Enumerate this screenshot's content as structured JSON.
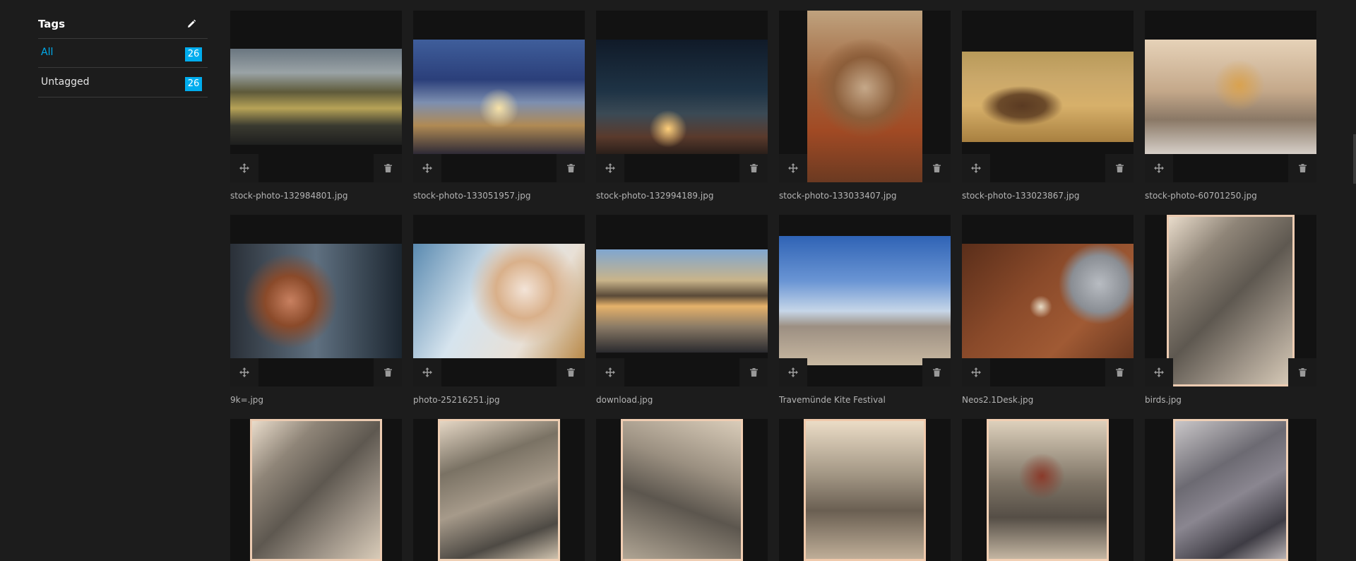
{
  "sidebar": {
    "title": "Tags",
    "tags": [
      {
        "label": "All",
        "count": "26",
        "active": true
      },
      {
        "label": "Untagged",
        "count": "26",
        "active": false
      }
    ]
  },
  "assets": [
    {
      "filename": "stock-photo-132984801.jpg",
      "image": "waterfall-landscape"
    },
    {
      "filename": "stock-photo-133051957.jpg",
      "image": "airplane-runway"
    },
    {
      "filename": "stock-photo-132994189.jpg",
      "image": "night-beach-campfire"
    },
    {
      "filename": "stock-photo-133033407.jpg",
      "image": "sadhu-portrait"
    },
    {
      "filename": "stock-photo-133023867.jpg",
      "image": "deer-in-field"
    },
    {
      "filename": "stock-photo-60701250.jpg",
      "image": "child-bicycle-house"
    },
    {
      "filename": "9k=.jpg",
      "image": "girl-at-window"
    },
    {
      "filename": "photo-25216251.jpg",
      "image": "woman-in-snow"
    },
    {
      "filename": "download.jpg",
      "image": "lake-boathouse"
    },
    {
      "filename": "Travemünde Kite Festival",
      "image": "kite-festival-beach"
    },
    {
      "filename": "Neos2.1Desk.jpg",
      "image": "desk-with-laptop"
    },
    {
      "filename": "birds.jpg",
      "image": "etching-griffin"
    },
    {
      "filename": "",
      "image": "etching-alice-1"
    },
    {
      "filename": "",
      "image": "etching-alice-2"
    },
    {
      "filename": "",
      "image": "etching-alice-3"
    },
    {
      "filename": "",
      "image": "etching-alice-4"
    },
    {
      "filename": "",
      "image": "etching-alice-5"
    },
    {
      "filename": "",
      "image": "etching-alice-6"
    }
  ],
  "colors": {
    "accent": "#00adee",
    "background": "#1c1c1c",
    "tile": "#121212"
  }
}
